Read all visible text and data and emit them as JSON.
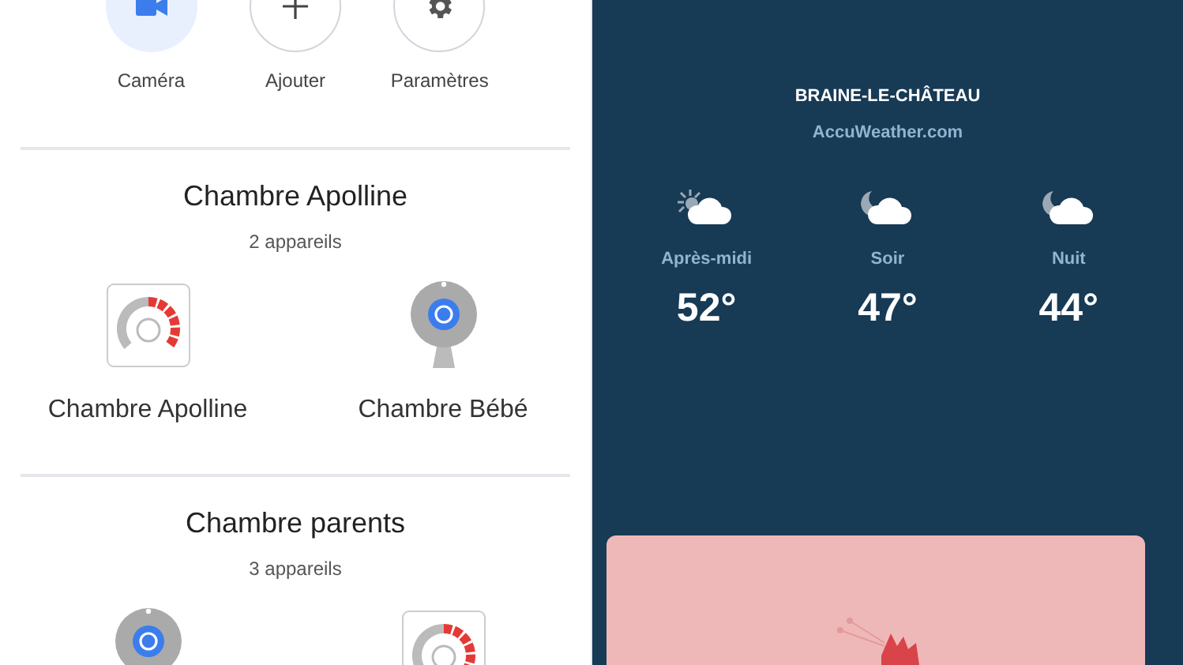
{
  "actions": [
    {
      "label": "Caméra",
      "kind": "camera",
      "selected": true
    },
    {
      "label": "Ajouter",
      "kind": "add",
      "selected": false
    },
    {
      "label": "Paramètres",
      "kind": "settings",
      "selected": false
    }
  ],
  "rooms": [
    {
      "title": "Chambre Apolline",
      "count": "2 appareils",
      "devices": [
        {
          "kind": "thermostat",
          "label": "Chambre Apolline"
        },
        {
          "kind": "camera",
          "label": "Chambre Bébé"
        }
      ]
    },
    {
      "title": "Chambre parents",
      "count": "3 appareils",
      "devices": [
        {
          "kind": "camera"
        },
        {
          "kind": "thermostat"
        }
      ]
    }
  ],
  "weather": {
    "location": "BRAINE-LE-CHÂTEAU",
    "source": "AccuWeather.com",
    "periods": [
      {
        "label": "Après-midi",
        "temp": "52°",
        "kind": "day"
      },
      {
        "label": "Soir",
        "temp": "47°",
        "kind": "night"
      },
      {
        "label": "Nuit",
        "temp": "44°",
        "kind": "night"
      }
    ]
  }
}
